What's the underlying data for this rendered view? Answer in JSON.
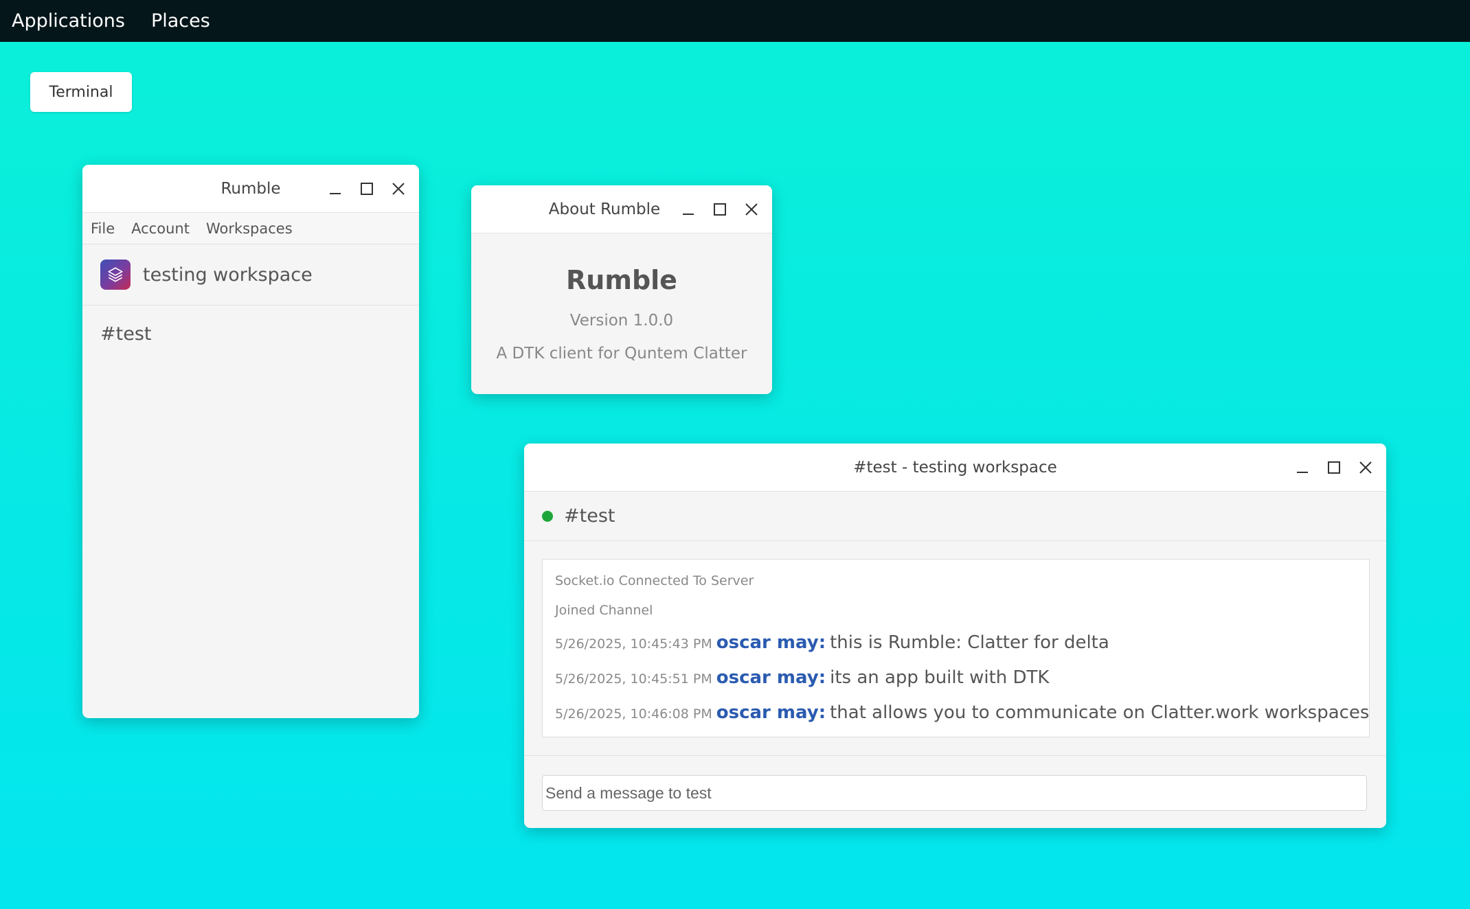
{
  "panel": {
    "menus": [
      "Applications",
      "Places"
    ]
  },
  "taskbar": {
    "terminal_label": "Terminal"
  },
  "main_window": {
    "title": "Rumble",
    "menu": [
      "File",
      "Account",
      "Workspaces"
    ],
    "workspace_name": "testing workspace",
    "channels": [
      "#test"
    ]
  },
  "about_window": {
    "title": "About Rumble",
    "app_name": "Rumble",
    "version": "Version 1.0.0",
    "description": "A DTK client for Quntem Clatter"
  },
  "chat_window": {
    "title": "#test - testing workspace",
    "channel": "#test",
    "status_color": "#1fa63b",
    "system_messages": [
      "Socket.io Connected To Server",
      "Joined Channel"
    ],
    "messages": [
      {
        "timestamp": "5/26/2025, 10:45:43 PM",
        "user": "oscar may:",
        "text": "this is Rumble: Clatter for delta"
      },
      {
        "timestamp": "5/26/2025, 10:45:51 PM",
        "user": "oscar may:",
        "text": "its an app built with DTK"
      },
      {
        "timestamp": "5/26/2025, 10:46:08 PM",
        "user": "oscar may:",
        "text": "that allows you to communicate on Clatter.work workspaces"
      }
    ],
    "composer_placeholder": "Send a message to test"
  },
  "icons": {
    "minimize": "minimize-icon",
    "maximize": "maximize-icon",
    "close": "close-icon",
    "workspace": "layers-icon"
  }
}
